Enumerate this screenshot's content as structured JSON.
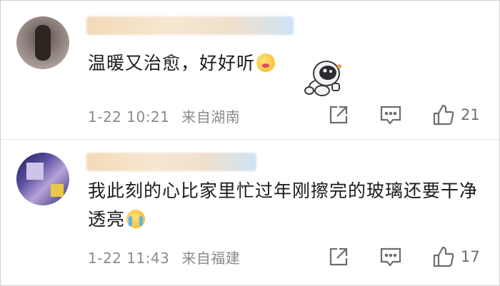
{
  "comments": [
    {
      "text": "温暖又治愈，好好听",
      "emoji": "kissing-heart-emoji",
      "sticker": "astronaut-sticker",
      "time": "1-22 10:21",
      "location": "来自湖南",
      "likes": "21"
    },
    {
      "text": "我此刻的心比家里忙过年刚擦完的玻璃还要干净透亮",
      "emoji": "crying-emoji",
      "time": "1-22 11:43",
      "location": "来自福建",
      "likes": "17"
    }
  ],
  "icons": {
    "share": "share-icon",
    "reply": "comment-icon",
    "like": "thumbs-up-icon"
  },
  "colors": {
    "text": "#1b1b1b",
    "meta": "#8a8a8a",
    "icon": "#6d6d6d"
  }
}
